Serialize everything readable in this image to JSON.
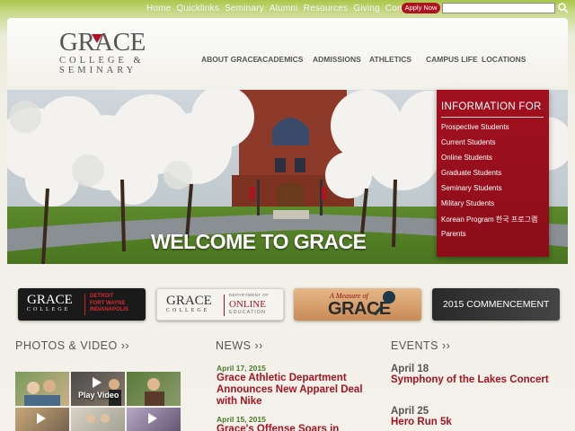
{
  "topnav": {
    "links": [
      "Home",
      "Quicklinks",
      "Seminary",
      "Alumni",
      "Resources",
      "Giving",
      "Contact"
    ],
    "apply_label": "Apply Now",
    "search_value": ""
  },
  "logo": {
    "line1": "GRACE",
    "line2": "COLLEGE &",
    "line3": "SEMINARY"
  },
  "mainnav": [
    "ABOUT GRACE",
    "ACADEMICS",
    "ADMISSIONS",
    "ATHLETICS",
    "CAMPUS LIFE",
    "LOCATIONS"
  ],
  "hero": {
    "welcome": "WELCOME TO GRACE"
  },
  "info_for": {
    "title": "INFORMATION FOR",
    "items": [
      "Prospective Students",
      "Current Students",
      "Online Students",
      "Graduate Students",
      "Seminary Students",
      "Military Students",
      "Korean Program 한국 프로그램",
      "Parents"
    ]
  },
  "promos": {
    "grace_college": "GRACE",
    "college": "COLLEGE",
    "cities": [
      "DETROIT",
      "FORT WAYNE",
      "INDIANAPOLIS"
    ],
    "department_of": "DEPARTMENT OF",
    "online": "ONLINE",
    "education": "EDUCATION",
    "measure_of": "A Measure of",
    "measure_grace": "GRACE",
    "commencement": "2015 COMMENCEMENT"
  },
  "sections": {
    "photos": "PHOTOS & VIDEO ››",
    "news": "NEWS ››",
    "events": "EVENTS ››",
    "play_video": "Play Video"
  },
  "news": [
    {
      "date": "April 17, 2015",
      "headline": "Grace Athletic Department Announces New Apparel Deal with Nike"
    },
    {
      "date": "April 15, 2015",
      "headline": "Grace's Offense Soars in"
    }
  ],
  "events": [
    {
      "date": "April 18",
      "title": "Symphony of the Lakes Concert"
    },
    {
      "date": "April 25",
      "title": "Hero Run 5k"
    }
  ],
  "colors": {
    "accent_red": "#a51420",
    "date_green": "#4a7a2b",
    "top_green": "#aac64a"
  }
}
